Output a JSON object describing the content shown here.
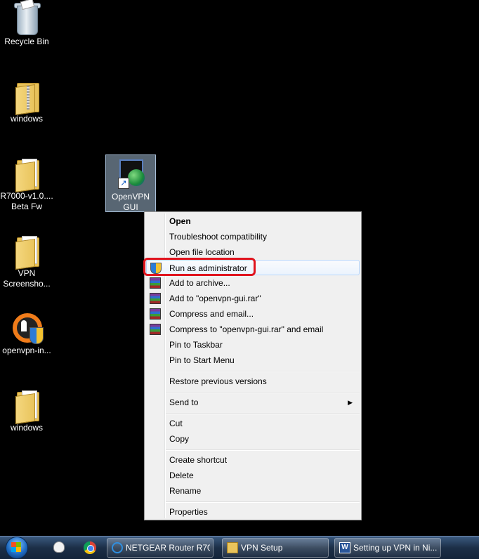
{
  "desktop": {
    "icons": [
      {
        "label": "Recycle Bin"
      },
      {
        "label": "windows"
      },
      {
        "label": "R7000-v1.0....\nBeta Fw"
      },
      {
        "label": "VPN\nScreensho..."
      },
      {
        "label": "openvpn-in..."
      },
      {
        "label": "windows"
      },
      {
        "label": "OpenVPN\nGUI"
      }
    ]
  },
  "context_menu": {
    "items": [
      {
        "label": "Open"
      },
      {
        "label": "Troubleshoot compatibility"
      },
      {
        "label": "Open file location"
      },
      {
        "label": "Run as administrator"
      },
      {
        "label": "Add to archive..."
      },
      {
        "label": "Add to \"openvpn-gui.rar\""
      },
      {
        "label": "Compress and email..."
      },
      {
        "label": "Compress to \"openvpn-gui.rar\" and email"
      },
      {
        "label": "Pin to Taskbar"
      },
      {
        "label": "Pin to Start Menu"
      },
      {
        "label": "Restore previous versions"
      },
      {
        "label": "Send to"
      },
      {
        "label": "Cut"
      },
      {
        "label": "Copy"
      },
      {
        "label": "Create shortcut"
      },
      {
        "label": "Delete"
      },
      {
        "label": "Rename"
      },
      {
        "label": "Properties"
      }
    ],
    "highlight_color": "#e0141e"
  },
  "taskbar": {
    "buttons": [
      {
        "label": "NETGEAR Router R70..."
      },
      {
        "label": "VPN Setup"
      },
      {
        "label": "Setting up VPN in Ni..."
      }
    ]
  }
}
